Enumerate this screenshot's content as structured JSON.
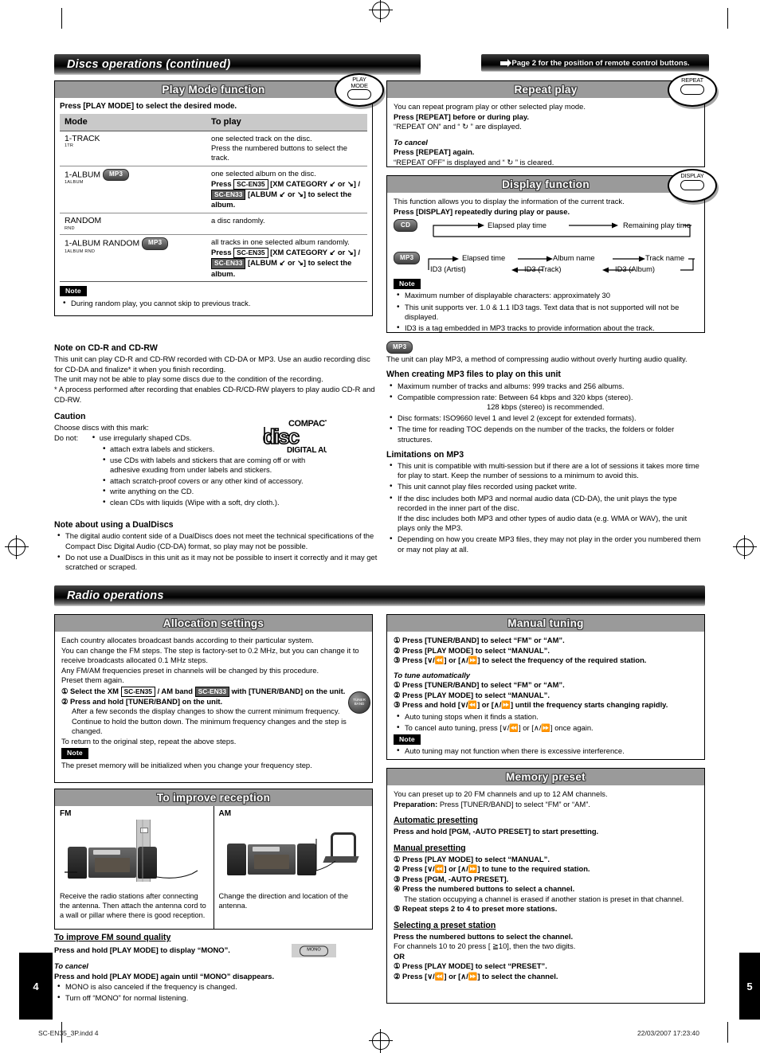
{
  "header": {
    "section_title": "Discs operations (continued)",
    "top_reference": "Page 2 for the position of remote control buttons."
  },
  "play_mode": {
    "title": "Play Mode function",
    "remote_button": {
      "line1": "PLAY",
      "line2": "MODE"
    },
    "intro": "Press [PLAY MODE] to select the desired mode.",
    "columns": [
      "Mode",
      "To play"
    ],
    "rows": [
      {
        "mode": "1-TRACK",
        "sub": "1TR",
        "badge": "",
        "desc_lines": [
          "one selected track on the disc.",
          "Press the numbered buttons to select the track."
        ]
      },
      {
        "mode": "1-ALBUM",
        "sub": "1ALBUM",
        "badge": "MP3",
        "desc_lines": [
          "one selected album on the disc."
        ],
        "press_line1_prefix": "Press",
        "press_model_a": "SC-EN35",
        "press_line1_mid": "[XM CATEGORY ↙ or ↘] /",
        "press_model_b": "SC-EN33",
        "press_line2": "[ALBUM ↙ or ↘] to select the album."
      },
      {
        "mode": "RANDOM",
        "sub": "RND",
        "badge": "",
        "desc_lines": [
          "a disc randomly."
        ]
      },
      {
        "mode": "1-ALBUM RANDOM",
        "sub": "1ALBUM RND",
        "badge": "MP3",
        "desc_lines": [
          "all tracks in one selected album randomly."
        ],
        "press_line1_prefix": "Press",
        "press_model_a": "SC-EN35",
        "press_line1_mid": "[XM CATEGORY ↙ or ↘] /",
        "press_model_b": "SC-EN33",
        "press_line2": "[ALBUM ↙ or ↘] to select the album."
      }
    ],
    "note_label": "Note",
    "note_items": [
      "During random play, you cannot skip to previous track."
    ]
  },
  "repeat_play": {
    "title": "Repeat play",
    "remote_button": {
      "line1": "REPEAT"
    },
    "line1": "You can repeat program play or other selected play mode.",
    "line2": "Press [REPEAT] before or during play.",
    "line3": "“REPEAT ON” and “ ↻ ” are displayed.",
    "cancel_heading": "To cancel",
    "cancel_line1": "Press [REPEAT] again.",
    "cancel_line2": "“REPEAT OFF” is displayed and “ ↻ ” is cleared."
  },
  "display_function": {
    "title": "Display function",
    "remote_button": {
      "line1": "DISPLAY"
    },
    "line1": "This function allows you to display the information of the current track.",
    "line2": "Press [DISPLAY] repeatedly during play or pause.",
    "cd_badge": "CD",
    "cd_flow": [
      "Elapsed play time",
      "Remaining play time"
    ],
    "mp3_badge": "MP3",
    "mp3_flow_top": [
      "Elapsed time",
      "Album name",
      "Track name"
    ],
    "mp3_flow_bottom": [
      "ID3 (Artist)",
      "ID3 (Track)",
      "ID3 (Album)"
    ],
    "note_label": "Note",
    "note_items": [
      "Maximum number of displayable characters: approximately 30",
      "This unit supports ver. 1.0 & 1.1 ID3 tags. Text data that is not supported will not be displayed.",
      "ID3 is a tag embedded in MP3 tracks to provide information about the track."
    ]
  },
  "cdr_note": {
    "heading": "Note on CD-R and CD-RW",
    "paragraphs": [
      "This unit can play CD-R and CD-RW recorded with CD-DA or MP3. Use an audio recording disc for CD-DA and finalize* it when you finish recording.",
      "The unit may not be able to play some discs due to the condition of the recording.",
      "* A process performed after recording that enables CD-R/CD-RW players to play audio CD-R and CD-RW."
    ]
  },
  "caution": {
    "heading": "Caution",
    "line1": "Choose discs with this mark:",
    "line2_prefix": "Do not:",
    "logo_text": {
      "top": "COMPACT",
      "mid": "disc",
      "bottom": "DIGITAL AUDIO"
    },
    "items": [
      "use irregularly shaped CDs.",
      "attach extra labels and stickers.",
      "use CDs with labels and stickers that are coming off or with adhesive exuding from under labels and stickers.",
      "attach scratch-proof covers or any other kind of accessory.",
      "write anything on the CD.",
      "clean CDs with liquids (Wipe with a soft, dry cloth.)."
    ]
  },
  "dualdisc": {
    "heading": "Note about using a DualDiscs",
    "items": [
      "The digital audio content side of a DualDiscs does not meet the technical specifications of the Compact Disc Digital Audio (CD-DA) format, so play may not be possible.",
      "Do not use a DualDiscs in this unit as it may not be possible to insert it correctly and it may get scratched or scraped."
    ]
  },
  "mp3_info": {
    "badge": "MP3",
    "intro": "The  unit can play MP3, a method of compressing audio without overly hurting audio quality.",
    "creating_heading": "When creating MP3 files to play on this unit",
    "creating_items": [
      "Maximum number of tracks and albums: 999 tracks and 256 albums.",
      "Compatible compression rate: Between 64 kbps and 320 kbps (stereo).",
      "Disc formats: ISO9660 level 1 and level 2 (except for extended formats).",
      "The time for reading TOC depends on the number of the tracks, the folders or folder structures."
    ],
    "recommend_line": "128 kbps (stereo) is recommended.",
    "limits_heading": "Limitations on MP3",
    "limits_items": [
      "This unit is compatible with multi-session but if there are a lot of sessions it takes more time for play to start. Keep the number of sessions to a minimum to avoid this.",
      "This unit cannot play files recorded using packet write.",
      "If the disc includes both MP3 and normal audio data (CD-DA), the unit plays the type recorded in the inner part of the disc.",
      "Depending on how you create MP3 files, they may not play in the order you numbered them or may not play at all."
    ],
    "limits_item3_extra": "If the disc includes both MP3 and other types of audio data (e.g. WMA or WAV), the unit plays only the MP3."
  },
  "radio": {
    "section_title": "Radio operations"
  },
  "allocation": {
    "title": "Allocation settings",
    "knob": {
      "line1": "TUNER",
      "line2": "BAND"
    },
    "paragraphs": [
      "Each country allocates broadcast bands according to their particular system.",
      "You can change the FM steps. The step is factory-set to 0.2 MHz, but you can change it to receive broadcasts allocated 0.1 MHz steps.",
      "Any FM/AM frequencies preset in channels will be changed by this procedure. Preset them again."
    ],
    "step1_prefix": "① Select the XM",
    "step1_model_a": "SC-EN35",
    "step1_mid": "/ AM band",
    "step1_model_b": "SC-EN33",
    "step1_suffix": "with [TUNER/BAND] on the unit.",
    "step2": "② Press and hold [TUNER/BAND] on the unit.",
    "step2_detail": "After a few seconds the display changes to show the current minimum frequency. Continue to hold the button down. The minimum frequency changes and the step is changed.",
    "return_line": "To return to the original step, repeat the above steps.",
    "note_label": "Note",
    "note_text": "The preset memory will be initialized when you change your frequency step."
  },
  "reception": {
    "title": "To improve reception",
    "fm_label": "FM",
    "am_label": "AM",
    "fm_text": "Receive the radio stations after connecting the antenna. Then attach the antenna cord to a wall or pillar where there is good reception.",
    "am_text": "Change the direction and location of the antenna."
  },
  "fm_sound": {
    "heading": "To improve FM sound quality",
    "line1": "Press and hold [PLAY MODE] to display “MONO”.",
    "chip_label": "MONO",
    "cancel_heading": "To cancel",
    "cancel_line": "Press and hold [PLAY MODE] again until “MONO” disappears.",
    "items": [
      "MONO is also canceled if the frequency is changed.",
      "Turn off “MONO” for normal listening."
    ]
  },
  "manual_tuning": {
    "title": "Manual tuning",
    "steps": [
      "① Press [TUNER/BAND] to select “FM” or “AM”.",
      "② Press [PLAY MODE] to select “MANUAL”.",
      "③ Press [∨/⏪] or [∧/⏩] to select the frequency of the required station."
    ],
    "auto_heading": "To tune automatically",
    "auto_steps": [
      "① Press [TUNER/BAND] to select “FM” or “AM”.",
      "② Press [PLAY MODE] to select “MANUAL”.",
      "③ Press and hold [∨/⏪] or [∧/⏩] until the frequency starts changing rapidly."
    ],
    "bullets": [
      "Auto tuning stops when it finds a station.",
      "To cancel auto tuning, press [∨/⏪] or [∧/⏩] once again."
    ],
    "note_label": "Note",
    "note_items": [
      "Auto tuning may not function when there is excessive interference."
    ]
  },
  "memory_preset": {
    "title": "Memory preset",
    "line1": "You can preset up to 20 FM channels and up to 12 AM channels.",
    "prep_label": "Preparation:",
    "prep_text": " Press [TUNER/BAND] to select “FM” or “AM”.",
    "auto_heading": "Automatic presetting",
    "auto_line": "Press and hold [PGM, -AUTO PRESET] to start presetting.",
    "manual_heading": "Manual presetting",
    "manual_steps": [
      "① Press [PLAY MODE] to select “MANUAL”.",
      "② Press [∨/⏪] or [∧/⏩] to tune to the required station.",
      "③ Press [PGM, -AUTO PRESET].",
      "④ Press the numbered buttons to select a channel.",
      "⑤ Repeat steps 2 to 4 to preset more stations."
    ],
    "step4_detail": "The station occupying a channel is erased if another station is preset in that channel.",
    "select_heading": "Selecting a preset station",
    "select_line1": "Press the numbered buttons to select the channel.",
    "select_line2": "For channels 10 to 20 press [ ≧10], then the two digits.",
    "or_label": "OR",
    "or_steps": [
      "① Press [PLAY MODE] to select “PRESET”.",
      "② Press [∨/⏪] or [∧/⏩] to select the channel."
    ]
  },
  "page_numbers": {
    "left": "4",
    "right": "5"
  },
  "footer": {
    "file": "SC-EN35_3P.indd   4",
    "timestamp": "22/03/2007   17:23:40"
  }
}
